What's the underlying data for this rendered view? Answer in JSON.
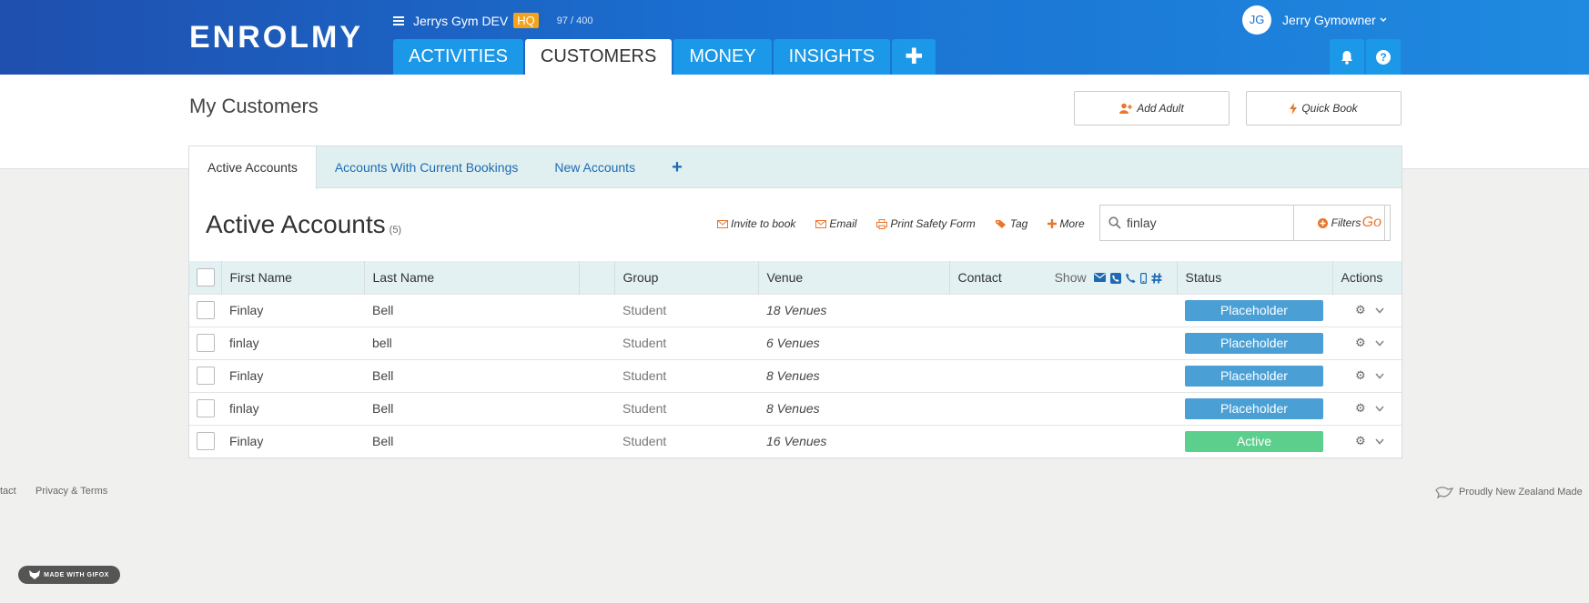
{
  "header": {
    "logo": "ENROLMY",
    "org_name": "Jerrys Gym DEV",
    "org_badge": "HQ",
    "usage": "97 / 400",
    "nav_tabs": [
      {
        "label": "ACTIVITIES"
      },
      {
        "label": "CUSTOMERS"
      },
      {
        "label": "MONEY"
      },
      {
        "label": "INSIGHTS"
      }
    ],
    "add_tab_symbol": "✚",
    "user_initials": "JG",
    "user_name": "Jerry Gymowner"
  },
  "page": {
    "title": "My Customers",
    "add_adult_label": "Add Adult",
    "quick_book_label": "Quick Book"
  },
  "subtabs": [
    {
      "label": "Active Accounts"
    },
    {
      "label": "Accounts With Current Bookings"
    },
    {
      "label": "New Accounts"
    }
  ],
  "section": {
    "title": "Active Accounts",
    "count": "(5)",
    "actions": {
      "invite": "Invite to book",
      "email": "Email",
      "print": "Print Safety Form",
      "tag": "Tag",
      "more": "More"
    },
    "search_value": "finlay",
    "go_label": "Go",
    "filters_label": "Filters"
  },
  "table": {
    "columns": {
      "first_name": "First Name",
      "last_name": "Last Name",
      "group": "Group",
      "venue": "Venue",
      "contact": "Contact",
      "show": "Show",
      "status": "Status",
      "actions": "Actions"
    },
    "rows": [
      {
        "first": "Finlay",
        "last": "Bell",
        "group": "Student",
        "venue": "18 Venues",
        "status": "Placeholder"
      },
      {
        "first": "finlay",
        "last": "bell",
        "group": "Student",
        "venue": "6 Venues",
        "status": "Placeholder"
      },
      {
        "first": "Finlay",
        "last": "Bell",
        "group": "Student",
        "venue": "8 Venues",
        "status": "Placeholder"
      },
      {
        "first": "finlay",
        "last": "Bell",
        "group": "Student",
        "venue": "8 Venues",
        "status": "Placeholder"
      },
      {
        "first": "Finlay",
        "last": "Bell",
        "group": "Student",
        "venue": "16 Venues",
        "status": "Active"
      }
    ]
  },
  "footer": {
    "contact": "tact",
    "privacy": "Privacy & Terms",
    "nz": "Proudly New Zealand Made"
  },
  "watermark": "MADE WITH GIFOX",
  "colors": {
    "header_start": "#1f4fae",
    "header_end": "#1f8ae0",
    "accent_orange": "#e8772e",
    "placeholder_status": "#4a9fd5",
    "active_status": "#5ccf8d"
  }
}
